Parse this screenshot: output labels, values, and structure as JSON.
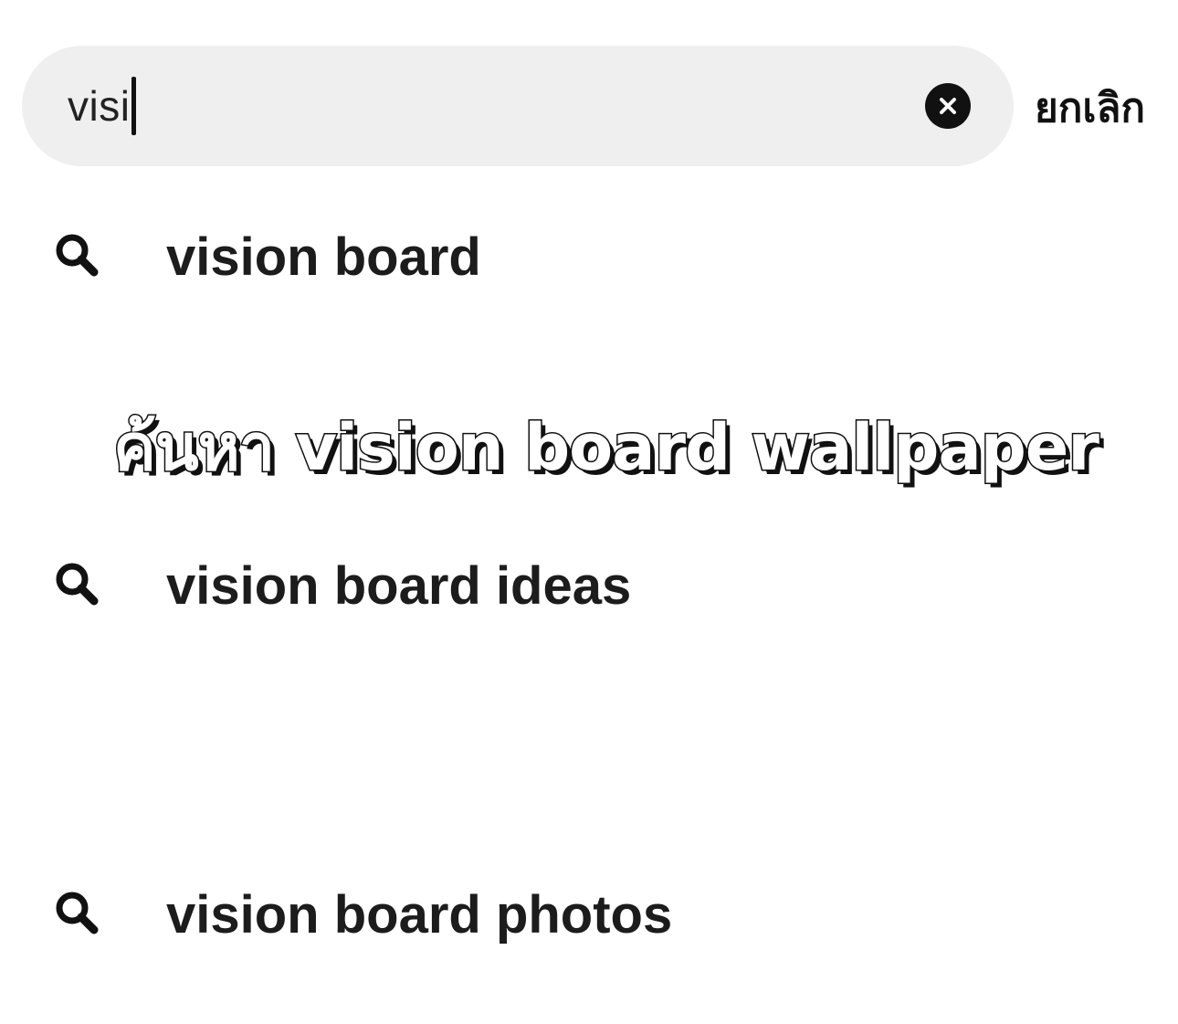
{
  "search": {
    "query": "visi",
    "clear_icon": "x-circle-icon",
    "cancel_label": "ยกเลิก"
  },
  "suggestions": [
    {
      "label": "vision board",
      "icon": "search-icon"
    },
    {
      "label": "vision board ideas",
      "icon": "search-icon"
    },
    {
      "label": "vision board photos",
      "icon": "search-icon"
    }
  ],
  "overlay": {
    "caption": "ค้นหา vision board wallpaper"
  },
  "colors": {
    "search_bg": "#efefef",
    "text": "#1c1c1c",
    "caption_fill": "#ffffff",
    "caption_outline": "#111111"
  }
}
